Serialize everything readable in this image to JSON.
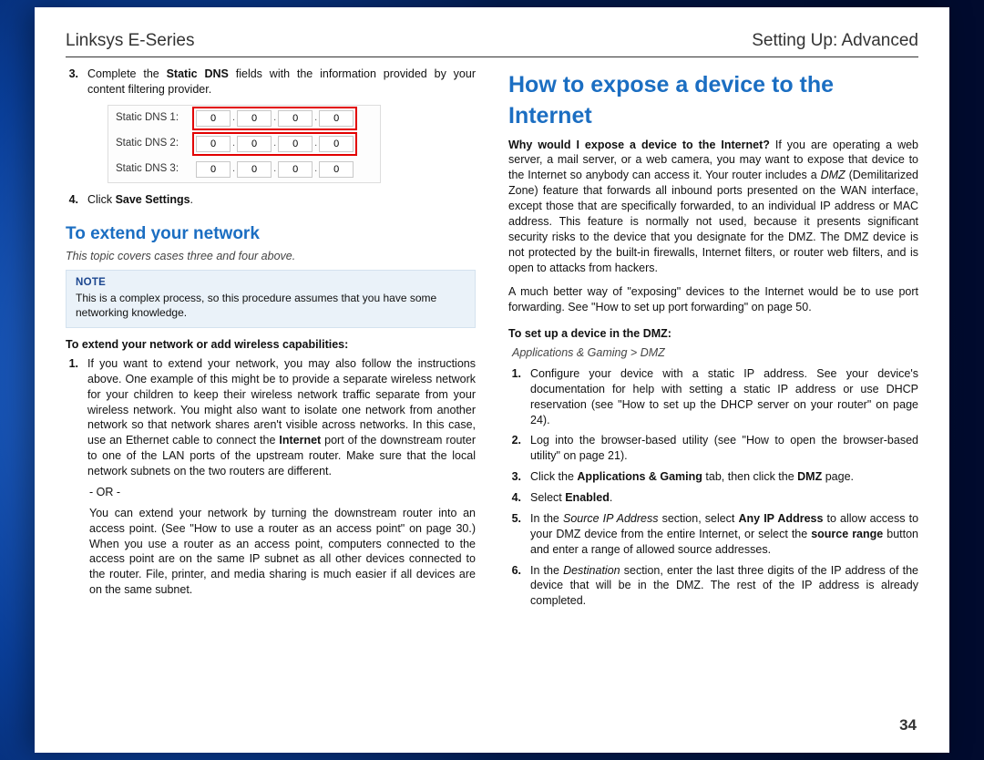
{
  "header": {
    "left": "Linksys E-Series",
    "right": "Setting Up: Advanced"
  },
  "pageNumber": "34",
  "left": {
    "step3": {
      "marker": "3.",
      "text_a": "Complete the ",
      "text_b": "Static DNS",
      "text_c": " fields with the information provided by your content filtering provider."
    },
    "dns": {
      "rows": [
        {
          "label": "Static DNS 1:",
          "v": [
            "0",
            "0",
            "0",
            "0"
          ],
          "hl": true
        },
        {
          "label": "Static DNS 2:",
          "v": [
            "0",
            "0",
            "0",
            "0"
          ],
          "hl": true
        },
        {
          "label": "Static DNS 3:",
          "v": [
            "0",
            "0",
            "0",
            "0"
          ],
          "hl": false
        }
      ]
    },
    "step4": {
      "marker": "4.",
      "text_a": "Click ",
      "text_b": "Save Settings",
      "text_c": "."
    },
    "subhead": "To extend your network",
    "ital": "This topic covers cases three and four above.",
    "note": {
      "label": "NOTE",
      "body": "This is a complex process, so this procedure assumes that you have some networking knowledge."
    },
    "boldline": "To extend your network or add wireless capabilities:",
    "step1": {
      "marker": "1.",
      "p1_a": "If you want to extend your network, you may also follow the instructions above. One example of this might be to provide a separate wireless network for your children to keep their wireless network traffic separate from your wireless network. You might also want to isolate one network from another network so that network shares aren't visible across networks. In this case, use an Ethernet cable to connect the ",
      "p1_b": "Internet",
      "p1_c": " port of the downstream router to one of the LAN ports of the upstream router. Make sure that the local network subnets on the two routers are different.",
      "or": "- OR -",
      "p2": "You can extend your network by turning the downstream router into an access point. (See \"How to use a router as an access point\" on page 30.) When you use a router as an access point, computers connected to the access point are on the same IP subnet as all other devices connected to the router. File, printer, and media sharing is much easier if all devices are on the same subnet."
    }
  },
  "right": {
    "bighead": "How to expose a device to the Internet",
    "intro": {
      "q": "Why would I expose a device to the Internet?",
      "body": " If you are operating a web server, a mail server, or a web camera, you may want to expose that device to the Internet so anybody can access it. Your router includes a ",
      "dmz": "DMZ",
      "body2": " (Demilitarized Zone) feature that forwards all inbound ports presented on the WAN interface, except those that are specifically forwarded, to an individual IP address or MAC address. This feature is normally not used, because it presents significant security risks to the device that you designate for the DMZ. The DMZ device is not protected by the built-in firewalls, Internet filters, or router web filters, and is open to attacks from hackers."
    },
    "para2": "A much better way of \"exposing\" devices to the Internet would be to use port forwarding. See \"How to set up port forwarding\" on page 50.",
    "boldline": "To set up a device in the DMZ:",
    "breadcrumb": "Applications & Gaming > DMZ",
    "steps": [
      {
        "marker": "1.",
        "plain_a": "Configure your device with a static IP address. See your device's documentation for help with setting a static IP address or use DHCP reservation (see \"How to set up the DHCP server on your router\" on page 24).",
        "bold_inline": ""
      },
      {
        "marker": "2.",
        "plain_a": "Log into the browser-based utility (see \"How to open the browser-based utility\" on page 21)."
      },
      {
        "marker": "3.",
        "a": "Click the ",
        "b": "Applications & Gaming",
        "c": " tab, then click the ",
        "d": "DMZ",
        "e": " page."
      },
      {
        "marker": "4.",
        "a": "Select ",
        "b": "Enabled",
        "c": "."
      },
      {
        "marker": "5.",
        "a": "In the ",
        "ital": "Source IP Address",
        "b": " section, select ",
        "bold1": "Any IP Address",
        "c": " to allow access to your DMZ device from the entire Internet, or select the ",
        "bold2": "source range",
        "d": " button and enter a range of allowed source addresses."
      },
      {
        "marker": "6.",
        "a": "In the ",
        "ital": "Destination",
        "b": " section, enter the last three digits of the IP address of the device that will be in the DMZ. The rest of the IP address is already completed."
      }
    ]
  }
}
